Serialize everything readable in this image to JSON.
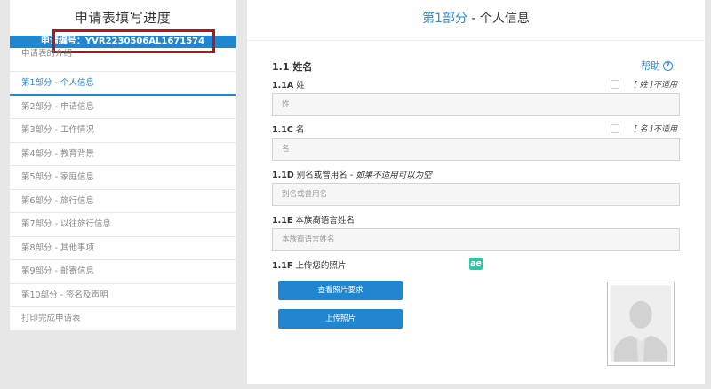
{
  "sidebar": {
    "title": "申请表填写进度",
    "app_id": "申请编号：YVR2230506AL1671574",
    "items": [
      {
        "label": "申请表的介绍"
      },
      {
        "label": "第1部分 - 个人信息"
      },
      {
        "label": "第2部分 - 申请信息"
      },
      {
        "label": "第3部分 - 工作情况"
      },
      {
        "label": "第4部分 - 教育背景"
      },
      {
        "label": "第5部分 - 家庭信息"
      },
      {
        "label": "第6部分 - 旅行信息"
      },
      {
        "label": "第7部分 - 以往旅行信息"
      },
      {
        "label": "第8部分 - 其他事项"
      },
      {
        "label": "第9部分 - 邮寄信息"
      },
      {
        "label": "第10部分 - 签名及声明"
      },
      {
        "label": "打印完成申请表"
      }
    ]
  },
  "main": {
    "header_part": "第1部分",
    "header_rest": " - 个人信息",
    "section_title": "1.1 姓名",
    "help": "帮助",
    "help_icon": "question-circle-icon",
    "fields": {
      "surname": {
        "code": "1.1A",
        "label": " 姓",
        "na": "[ 姓 ]不适用",
        "placeholder": "姓"
      },
      "given": {
        "code": "1.1C",
        "label": " 名",
        "na": "[ 名 ]不适用",
        "placeholder": "名"
      },
      "alias": {
        "code": "1.1D",
        "label": " 别名或曾用名 - ",
        "hint": "如果不适用可以为空",
        "placeholder": "别名或曾用名"
      },
      "native": {
        "code": "1.1E",
        "label": " 本族裔语言姓名",
        "placeholder": "本族裔语言姓名"
      },
      "photo": {
        "code": "1.1F",
        "label": " 上传您的照片"
      }
    },
    "ae_icon": "ae",
    "buttons": {
      "view_req": "查看照片要求",
      "upload": "上传照片"
    }
  },
  "colors": {
    "accent": "#1f86cf",
    "highlight_box": "#b3161b",
    "ae_green": "#33c6a6"
  }
}
